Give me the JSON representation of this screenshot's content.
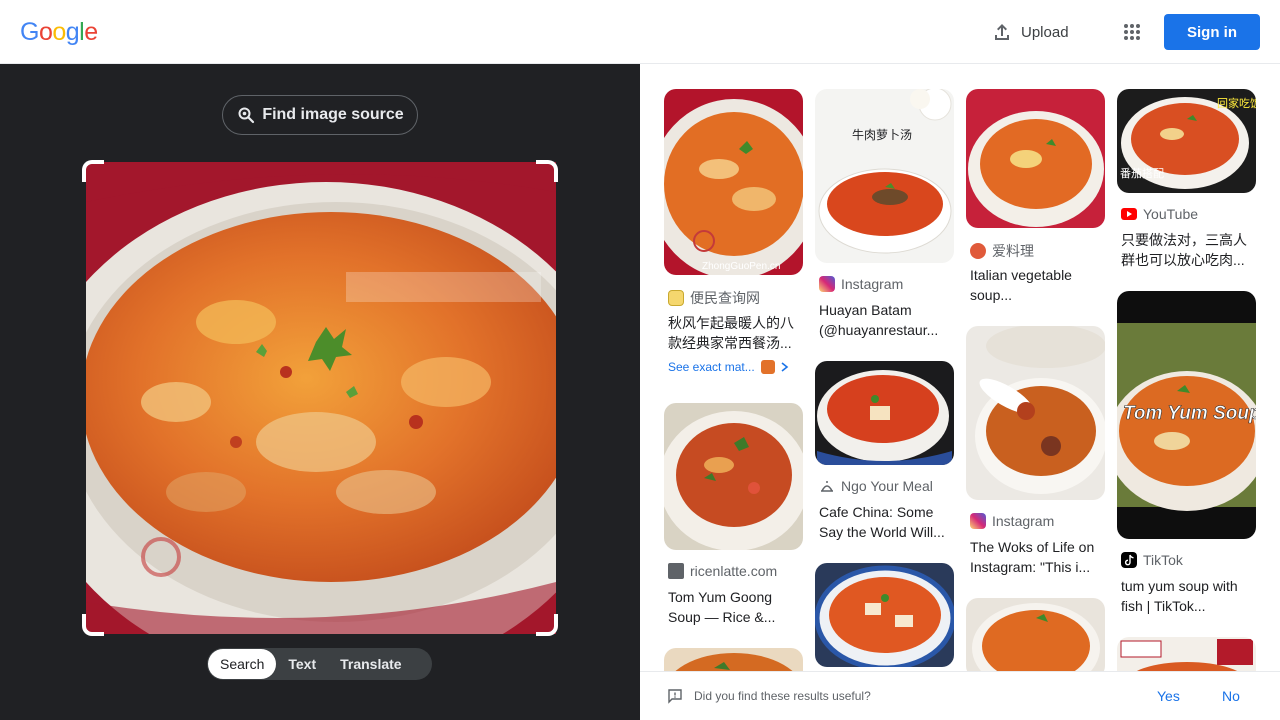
{
  "header": {
    "logo": [
      "G",
      "o",
      "o",
      "g",
      "l",
      "e"
    ],
    "upload_label": "Upload",
    "signin_label": "Sign in"
  },
  "left_panel": {
    "find_source_label": "Find image source",
    "modes": [
      "Search",
      "Text",
      "Translate"
    ]
  },
  "results": [
    {
      "source": "便民查询网",
      "title": "秋风乍起最暖人的八款经典家常西餐汤...",
      "see_exact": "See exact mat...",
      "watermark": "ZhongGuoPen.cn"
    },
    {
      "source": "ricenlatte.com",
      "title": "Tom Yum Goong Soup — Rice &..."
    },
    {
      "source": "Instagram",
      "title": "Huayan Batam (@huayanrestaur...",
      "thumb_text": "牛肉萝卜汤"
    },
    {
      "source": "Ngo Your Meal",
      "title": "Cafe China: Some Say the World Will..."
    },
    {
      "source": "爱料理",
      "title": "Italian vegetable soup..."
    },
    {
      "source": "Instagram",
      "title": "The Woks of Life on Instagram: \"This i..."
    },
    {
      "source": "YouTube",
      "title": "只要做法对，三高人群也可以放心吃肉...",
      "thumb_text": "番茄搭配",
      "thumb_text2": "回家吃饭"
    },
    {
      "source": "TikTok",
      "title": "tum yum soup with fish | TikTok...",
      "thumb_text": "Tom Yum Soup"
    }
  ],
  "feedback": {
    "question": "Did you find these results useful?",
    "yes": "Yes",
    "no": "No"
  },
  "colors": {
    "blue": "#4285F4",
    "red": "#EA4335",
    "yellow": "#FBBC05",
    "green": "#34A853",
    "signin_bg": "#1a73e8",
    "dark_panel": "#202124"
  }
}
